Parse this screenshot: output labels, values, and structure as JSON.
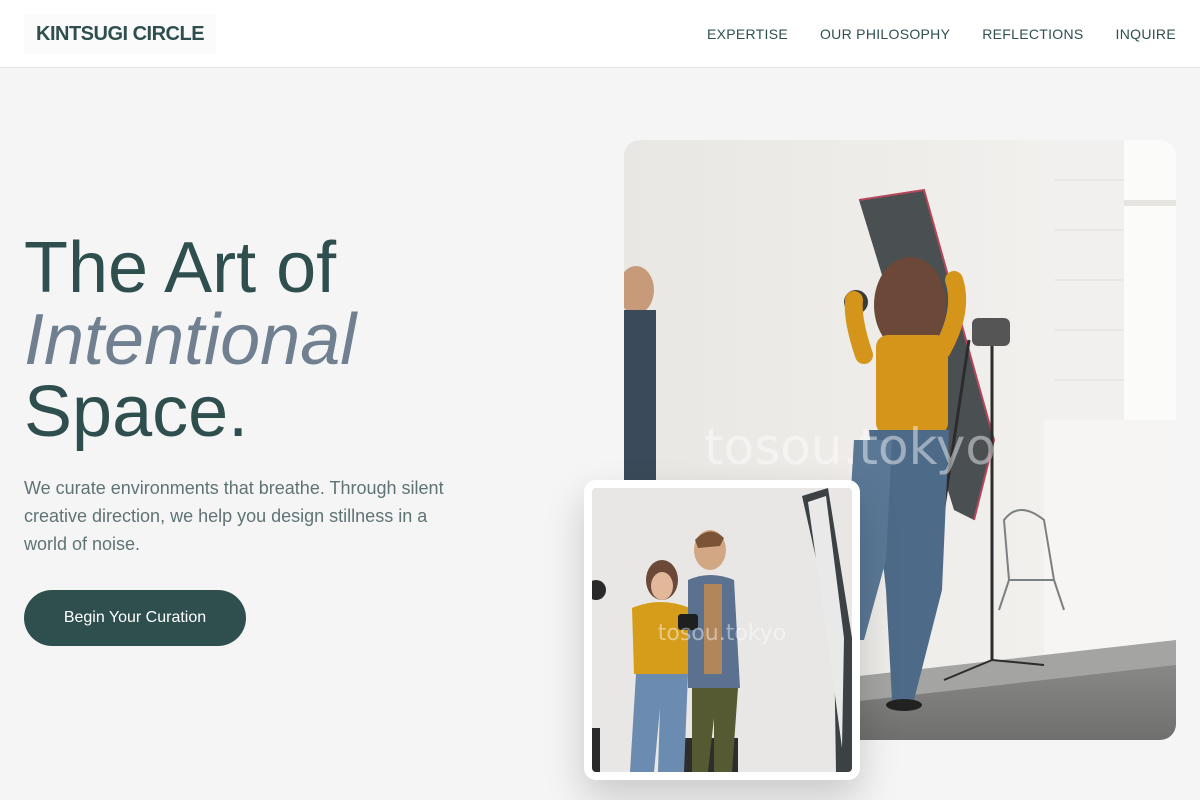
{
  "brand": "KINTSUGI CIRCLE",
  "nav": [
    "EXPERTISE",
    "OUR PHILOSOPHY",
    "REFLECTIONS",
    "INQUIRE"
  ],
  "hero": {
    "line1": "The Art of",
    "line2": "Intentional",
    "line3": "Space.",
    "description": "We curate environments that breathe. Through silent creative direction, we help you design stillness in a world of noise.",
    "cta": "Begin Your Curation"
  },
  "images": {
    "main_watermark": "tosou.tokyo",
    "card_watermark": "tosou.tokyo"
  },
  "colors": {
    "primary": "#2f4f4f",
    "accent": "#708090",
    "background": "#f5f5f5"
  }
}
